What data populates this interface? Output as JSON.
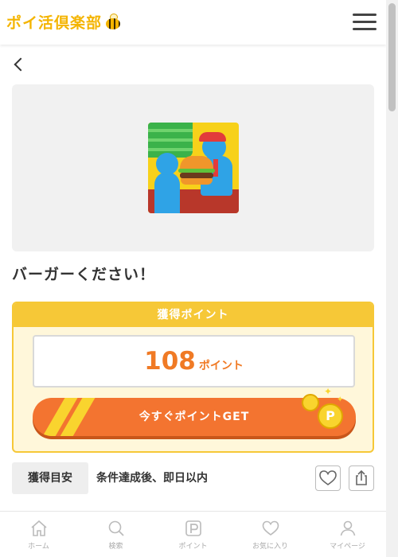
{
  "header": {
    "logo_text": "ポイ活倶楽部",
    "logo_icon": "bee-icon",
    "menu_icon": "hamburger-menu-icon"
  },
  "nav": {
    "back_icon": "chevron-left-icon"
  },
  "app": {
    "title": "バーガーください！",
    "icon": "burger-game-app-icon"
  },
  "points": {
    "header": "獲得ポイント",
    "value": "108",
    "unit": "ポイント",
    "cta_label": "今すぐポイントGET",
    "coin_icon": "coin-p-icon",
    "accent": "#f6c837",
    "cta_color": "#f37430",
    "value_color": "#f07a25"
  },
  "meta": {
    "label": "獲得目安",
    "value": "条件達成後、即日以内",
    "favorite_icon": "heart-icon",
    "share_icon": "share-icon"
  },
  "bottom_nav": {
    "items": [
      {
        "label": "ホーム",
        "icon": "home-icon"
      },
      {
        "label": "検索",
        "icon": "search-icon"
      },
      {
        "label": "ポイント",
        "icon": "point-p-icon"
      },
      {
        "label": "お気に入り",
        "icon": "heart-icon"
      },
      {
        "label": "マイページ",
        "icon": "user-icon"
      }
    ]
  }
}
